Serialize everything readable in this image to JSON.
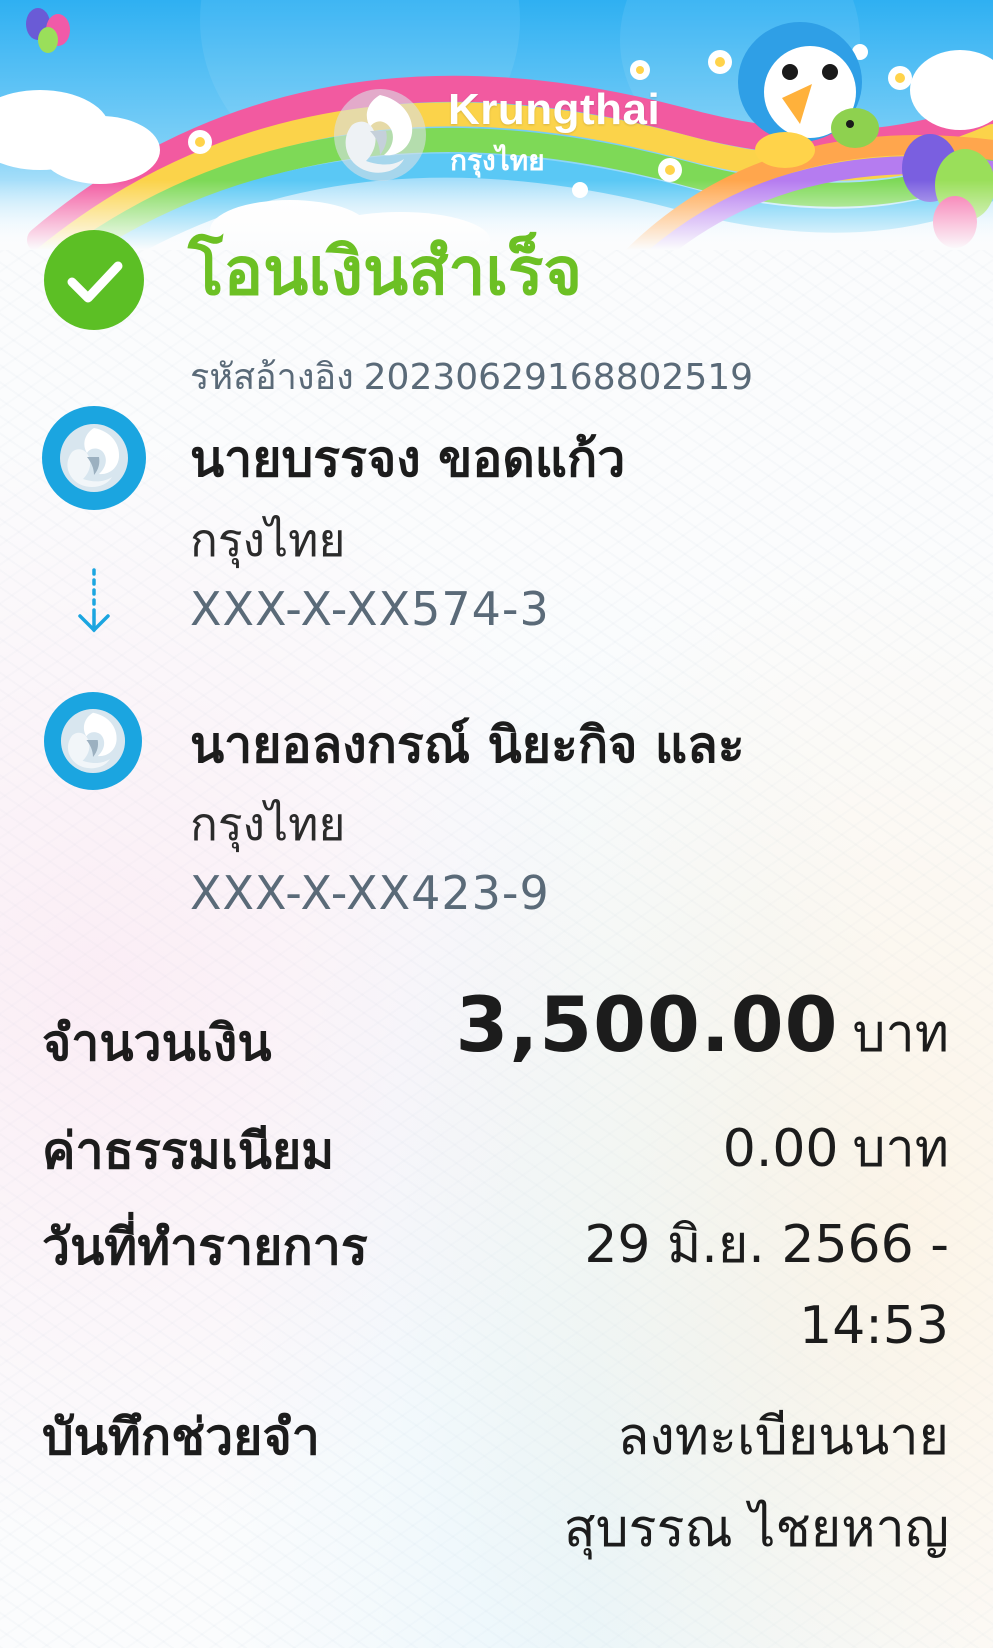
{
  "header": {
    "brand_name": "Krungthai",
    "brand_thai": "กรุงไทย"
  },
  "status": {
    "title": "โอนเงินสำเร็จ",
    "reference_label": "รหัสอ้างอิง",
    "reference_number": "20230629168802519",
    "color": "#6cc024"
  },
  "sender": {
    "name": "นายบรรจง ขอดแก้ว",
    "bank": "กรุงไทย",
    "account": "XXX-X-XX574-3"
  },
  "receiver": {
    "name": "นายอลงกรณ์ นิยะกิจ และ",
    "bank": "กรุงไทย",
    "account": "XXX-X-XX423-9"
  },
  "details": {
    "amount_label": "จำนวนเงิน",
    "amount_value": "3,500.00",
    "amount_unit": "บาท",
    "fee_label": "ค่าธรรมเนียม",
    "fee_value": "0.00",
    "fee_unit": "บาท",
    "date_label": "วันที่ทำรายการ",
    "date_value_line1": "29 มิ.ย. 2566 -",
    "date_value_line2": "14:53",
    "memo_label": "บันทึกช่วยจำ",
    "memo_value_line1": "ลงทะเบียนนาย",
    "memo_value_line2": "สุบรรณ ไชยหาญ"
  },
  "icons": {
    "success": "check-circle-icon",
    "bank_logo": "krungthai-logo-icon",
    "transfer_arrow": "dotted-down-arrow-icon"
  },
  "colors": {
    "accent_blue": "#1ba5e0",
    "success_green": "#6cc024",
    "sky": "#3fb4f0"
  }
}
